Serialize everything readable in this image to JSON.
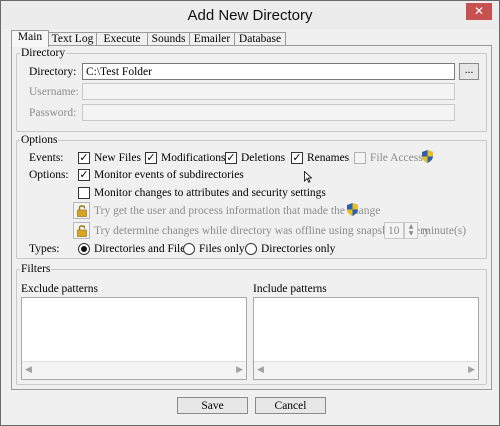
{
  "window": {
    "title": "Add New Directory",
    "close_glyph": "✕"
  },
  "tabs": [
    {
      "label": "Main",
      "active": true
    },
    {
      "label": "Text Log"
    },
    {
      "label": "Execute"
    },
    {
      "label": "Sounds"
    },
    {
      "label": "Emailer"
    },
    {
      "label": "Database"
    }
  ],
  "directory_group": {
    "legend": "Directory",
    "directory_label": "Directory:",
    "directory_value": "C:\\Test Folder",
    "browse_label": "...",
    "username_label": "Username:",
    "username_value": "",
    "password_label": "Password:",
    "password_value": ""
  },
  "options_group": {
    "legend": "Options",
    "events_label": "Events:",
    "events": [
      {
        "label": "New Files",
        "checked": true
      },
      {
        "label": "Modifications",
        "checked": true
      },
      {
        "label": "Deletions",
        "checked": true
      },
      {
        "label": "Renames",
        "checked": true
      },
      {
        "label": "File Access",
        "checked": false,
        "disabled": true
      }
    ],
    "options_label": "Options:",
    "monitor_subdirs": {
      "label": "Monitor events of subdirectories",
      "checked": true
    },
    "monitor_attributes": {
      "label": "Monitor changes to attributes and security settings",
      "checked": false
    },
    "try_user_info": {
      "label": "Try get the user and process information that made the change",
      "disabled": true
    },
    "try_snapshots": {
      "label": "Try determine changes while directory was offline using snapshots every",
      "disabled": true
    },
    "snapshot_interval": "10",
    "minutes_label": "minute(s)",
    "types_label": "Types:",
    "types": [
      {
        "label": "Directories and Files",
        "selected": true
      },
      {
        "label": "Files only",
        "selected": false
      },
      {
        "label": "Directories only",
        "selected": false
      }
    ]
  },
  "filters_group": {
    "legend": "Filters",
    "exclude_label": "Exclude patterns",
    "include_label": "Include patterns",
    "scroll_left": "◀",
    "scroll_right": "▶"
  },
  "footer": {
    "save_label": "Save",
    "cancel_label": "Cancel"
  },
  "colors": {
    "close_button": "#c75050",
    "shield_blue": "#2a5fb0",
    "shield_yellow": "#e8c020",
    "lock_gold": "#d9a520"
  }
}
